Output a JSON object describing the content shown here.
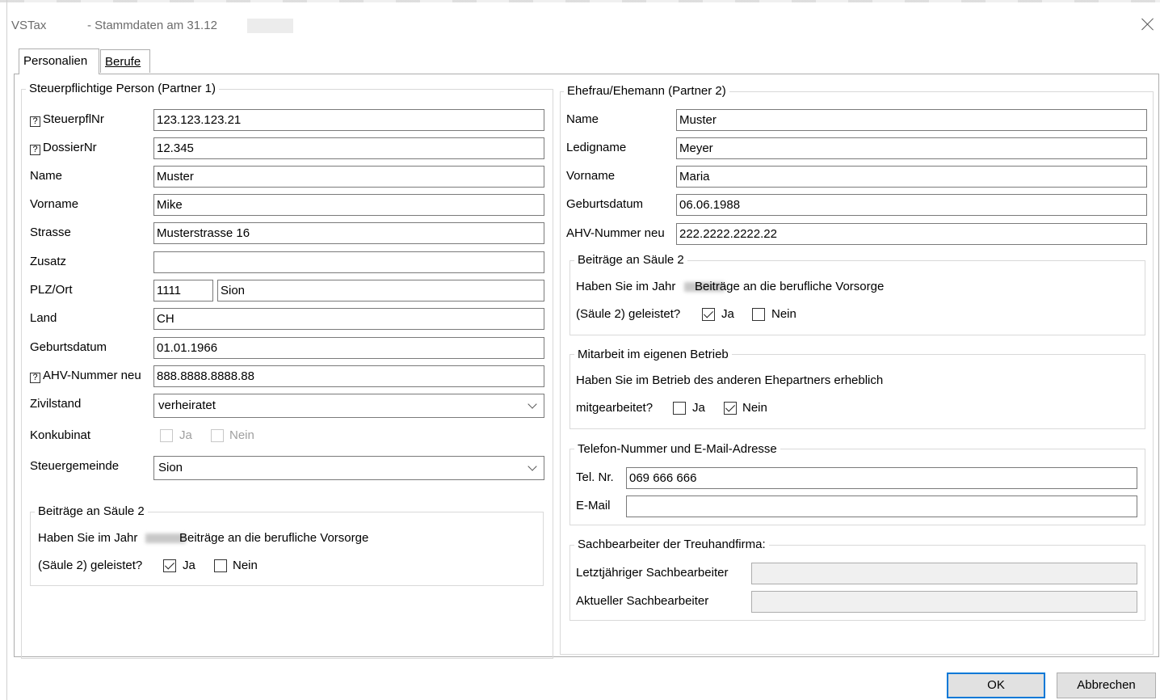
{
  "window": {
    "app": "VSTax",
    "title": "- Stammdaten am 31.12"
  },
  "tabs": [
    "Personalien",
    "Berufe"
  ],
  "partner1": {
    "group_title": "Steuerpflichtige Person (Partner 1)",
    "fields": {
      "steuerpflnr": {
        "label": "SteuerpflNr",
        "value": "123.123.123.21"
      },
      "dossiernr": {
        "label": "DossierNr",
        "value": "12.345"
      },
      "name": {
        "label": "Name",
        "value": "Muster"
      },
      "vorname": {
        "label": "Vorname",
        "value": "Mike"
      },
      "strasse": {
        "label": "Strasse",
        "value": "Musterstrasse 16"
      },
      "zusatz": {
        "label": "Zusatz",
        "value": ""
      },
      "plzort": {
        "label": "PLZ/Ort",
        "plz": "1111",
        "ort": "Sion"
      },
      "land": {
        "label": "Land",
        "value": "CH"
      },
      "geburtsdatum": {
        "label": "Geburtsdatum",
        "value": "01.01.1966"
      },
      "ahv": {
        "label": "AHV-Nummer neu",
        "value": "888.8888.8888.88"
      },
      "zivilstand": {
        "label": "Zivilstand",
        "value": "verheiratet"
      },
      "konkubinat": {
        "label": "Konkubinat",
        "ja": "Ja",
        "nein": "Nein"
      },
      "steuergemeinde": {
        "label": "Steuergemeinde",
        "value": "Sion"
      }
    },
    "saeule2": {
      "title": "Beiträge an Säule 2",
      "line1_prefix": "Haben Sie im Jahr",
      "line1_suffix": "Beiträge an die berufliche Vorsorge",
      "line2": "(Säule 2) geleistet?",
      "ja": "Ja",
      "nein": "Nein",
      "ja_checked": true,
      "nein_checked": false
    }
  },
  "partner2": {
    "group_title": "Ehefrau/Ehemann (Partner 2)",
    "fields": {
      "name": {
        "label": "Name",
        "value": "Muster"
      },
      "ledigname": {
        "label": "Ledigname",
        "value": "Meyer"
      },
      "vorname": {
        "label": "Vorname",
        "value": "Maria"
      },
      "geburtsdatum": {
        "label": "Geburtsdatum",
        "value": "06.06.1988"
      },
      "ahv": {
        "label": "AHV-Nummer neu",
        "value": "222.2222.2222.22"
      }
    },
    "saeule2": {
      "title": "Beiträge an Säule 2",
      "line1_prefix": "Haben Sie im Jahr",
      "line1_suffix": "Beiträge an die berufliche Vorsorge",
      "line2": "(Säule 2) geleistet?",
      "ja": "Ja",
      "nein": "Nein",
      "ja_checked": true,
      "nein_checked": false
    },
    "mitarbeit": {
      "title": "Mitarbeit im eigenen Betrieb",
      "line1": "Haben Sie im Betrieb des anderen Ehepartners erheblich",
      "line2": "mitgearbeitet?",
      "ja": "Ja",
      "nein": "Nein",
      "ja_checked": false,
      "nein_checked": true
    },
    "kontakt": {
      "title": "Telefon-Nummer und E-Mail-Adresse",
      "tel_label": "Tel. Nr.",
      "tel_value": "069 666 666",
      "email_label": "E-Mail",
      "email_value": ""
    },
    "sachbearbeiter": {
      "title": "Sachbearbeiter der Treuhandfirma:",
      "letzt_label": "Letztjähriger Sachbearbeiter",
      "letzt_value": "",
      "aktuell_label": "Aktueller Sachbearbeiter",
      "aktuell_value": ""
    }
  },
  "buttons": {
    "ok": "OK",
    "cancel": "Abbrechen"
  }
}
